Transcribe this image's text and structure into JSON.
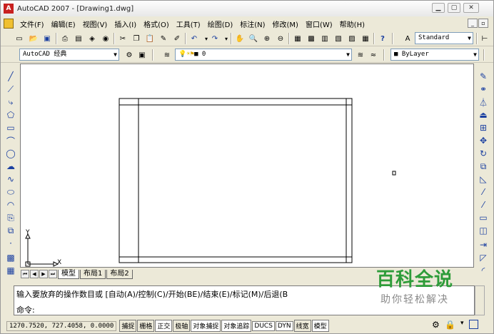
{
  "window": {
    "title": "AutoCAD 2007 - [Drawing1.dwg]"
  },
  "menu": [
    "文件(F)",
    "编辑(E)",
    "视图(V)",
    "插入(I)",
    "格式(O)",
    "工具(T)",
    "绘图(D)",
    "标注(N)",
    "修改(M)",
    "窗口(W)",
    "帮助(H)"
  ],
  "toolbar": {
    "text_style": "Standard",
    "workspace": "AutoCAD 经典",
    "layer": "0",
    "color": "ByLayer"
  },
  "layout_tabs": [
    "模型",
    "布局1",
    "布局2"
  ],
  "command": {
    "line1": "输入要放弃的操作数目或 [自动(A)/控制(C)/开始(BE)/结束(E)/标记(M)/后退(B",
    "line2": "命令:"
  },
  "status": {
    "coords": "1270.7520,  727.4058,  0.0000",
    "buttons": [
      "捕捉",
      "栅格",
      "正交",
      "极轴",
      "对象捕捉",
      "对象追踪",
      "DUCS",
      "DYN",
      "线宽",
      "模型"
    ]
  },
  "ucs": {
    "x": "X",
    "y": "Y"
  },
  "watermark": {
    "title": "百科全说",
    "subtitle": "助你轻松解决"
  }
}
